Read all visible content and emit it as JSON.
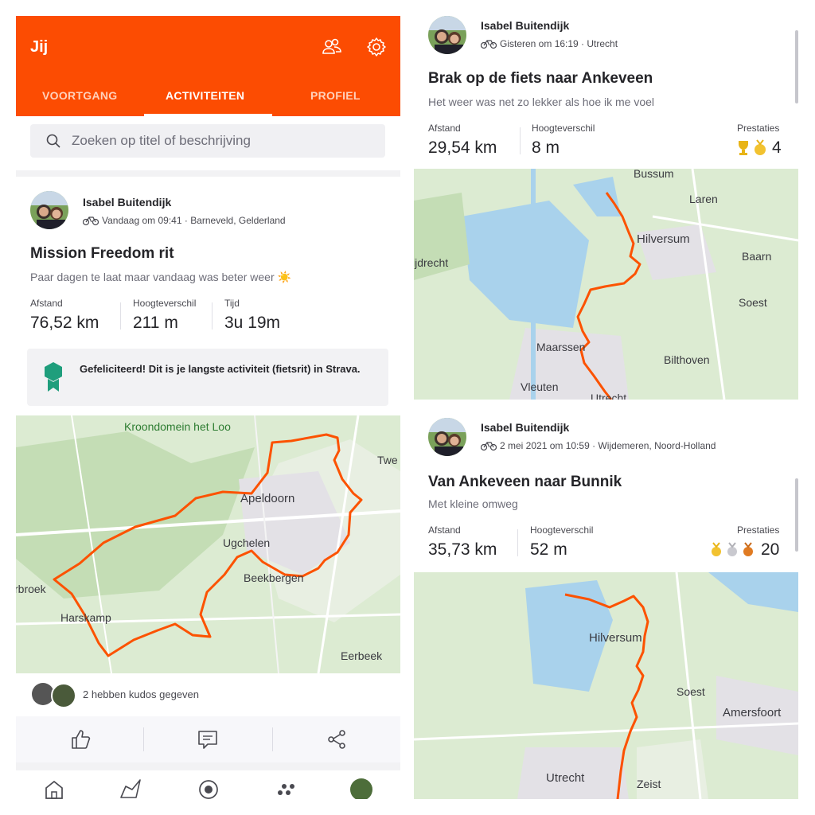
{
  "app": {
    "title": "Jij",
    "tabs": [
      {
        "label": "VOORTGANG"
      },
      {
        "label": "ACTIVITEITEN"
      },
      {
        "label": "PROFIEL"
      }
    ],
    "search_placeholder": "Zoeken op titel of beschrijving"
  },
  "feed": [
    {
      "athlete": "Isabel Buitendijk",
      "meta": "Vandaag om 09:41 · Barneveld, Gelderland",
      "title": "Mission Freedom rit",
      "description": "Paar dagen te laat maar vandaag was beter weer ☀️",
      "stats": [
        {
          "label": "Afstand",
          "value": "76,52 km"
        },
        {
          "label": "Hoogteverschil",
          "value": "211 m"
        },
        {
          "label": "Tijd",
          "value": "3u 19m"
        }
      ],
      "achievement": "Gefeliciteerd! Dit is je langste activiteit (fietsrit) in Strava.",
      "map_labels": [
        "Kroondomein het Loo",
        "Apeldoorn",
        "Ugchelen",
        "Beekbergen",
        "Harskamp",
        "rbroek",
        "Twe",
        "Eerbeek"
      ],
      "kudos_text": "2 hebben kudos gegeven"
    },
    {
      "athlete": "Isabel Buitendijk",
      "meta": "Gisteren om 16:19 · Utrecht",
      "title": "Brak op de fiets naar Ankeveen",
      "description": "Het weer was net zo lekker als hoe ik me voel",
      "stats": [
        {
          "label": "Afstand",
          "value": "29,54 km"
        },
        {
          "label": "Hoogteverschil",
          "value": "8 m"
        }
      ],
      "achievements_label": "Prestaties",
      "achievements_count": "4",
      "map_labels": [
        "Bussum",
        "Laren",
        "Hilversum",
        "Baarn",
        "ijdrecht",
        "Soest",
        "Maarssen",
        "Bilthoven",
        "Vleuten",
        "Utrecht"
      ]
    },
    {
      "athlete": "Isabel Buitendijk",
      "meta": "2 mei 2021 om 10:59 · Wijdemeren, Noord-Holland",
      "title": "Van Ankeveen naar Bunnik",
      "description": "Met kleine omweg",
      "stats": [
        {
          "label": "Afstand",
          "value": "35,73 km"
        },
        {
          "label": "Hoogteverschil",
          "value": "52 m"
        }
      ],
      "achievements_label": "Prestaties",
      "achievements_count": "20",
      "map_labels": [
        "Hilversum",
        "Soest",
        "Amersfoort",
        "Utrecht",
        "Zeist"
      ]
    }
  ],
  "colors": {
    "brand": "#fc4c02",
    "route": "#fc5200",
    "achievement_badge": "#1f9e7c"
  },
  "icons": [
    "people-icon",
    "gear-icon",
    "search-icon",
    "bike-icon",
    "badge-icon",
    "thumbs-up-icon",
    "comment-icon",
    "share-icon",
    "home-icon",
    "maps-icon",
    "record-icon",
    "groups-icon",
    "trophy-icon",
    "medal-icon"
  ]
}
